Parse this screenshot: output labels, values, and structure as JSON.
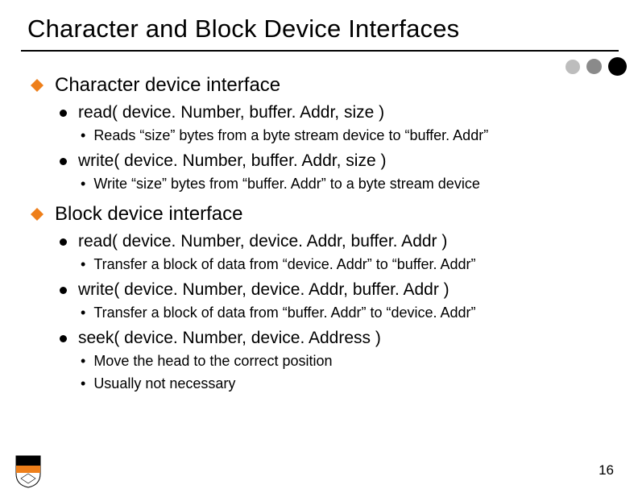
{
  "slide": {
    "title": "Character and Block Device Interfaces",
    "page_number": "16",
    "accent_color": "#ee7f1a",
    "sections": [
      {
        "heading": "Character device interface",
        "items": [
          {
            "text": "read( device. Number, buffer. Addr, size )",
            "subs": [
              "Reads “size” bytes from a byte stream device to “buffer. Addr”"
            ]
          },
          {
            "text": "write( device. Number, buffer. Addr, size )",
            "subs": [
              "Write “size” bytes from “buffer. Addr” to a byte stream device"
            ]
          }
        ]
      },
      {
        "heading": "Block device interface",
        "items": [
          {
            "text": "read( device. Number, device. Addr, buffer. Addr )",
            "subs": [
              "Transfer a block of data from “device. Addr” to “buffer. Addr”"
            ]
          },
          {
            "text": "write( device. Number, device. Addr, buffer. Addr )",
            "subs": [
              "Transfer a block of data from “buffer. Addr” to “device. Addr”"
            ]
          },
          {
            "text": "seek( device. Number, device. Address )",
            "subs": [
              "Move the head to the correct position",
              "Usually not necessary"
            ]
          }
        ]
      }
    ]
  }
}
